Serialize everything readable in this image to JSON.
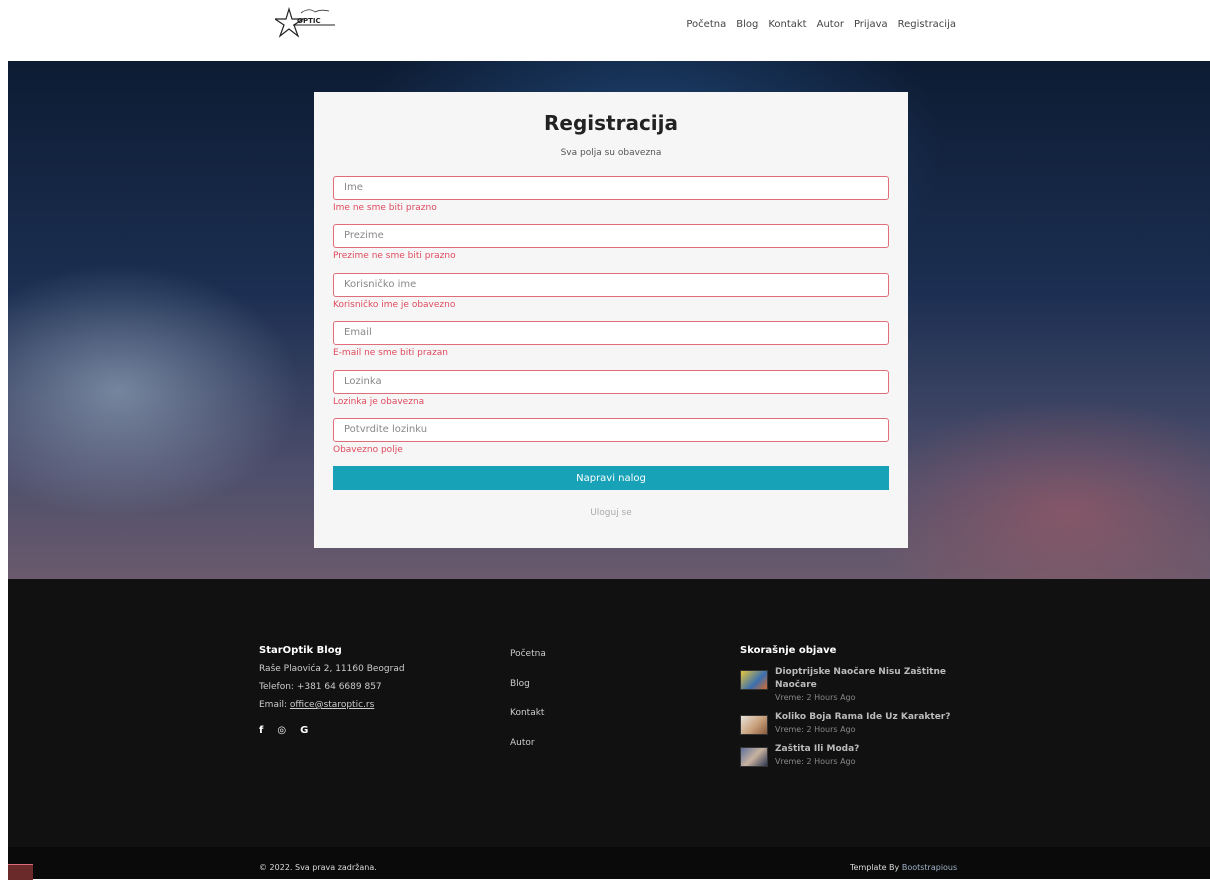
{
  "header": {
    "logo_text": "OPTIC",
    "nav": [
      "Početna",
      "Blog",
      "Kontakt",
      "Autor",
      "Prijava",
      "Registracija"
    ]
  },
  "form": {
    "title": "Registracija",
    "subtitle": "Sva polja su obavezna",
    "fields": [
      {
        "placeholder": "Ime",
        "error": "Ime ne sme biti prazno"
      },
      {
        "placeholder": "Prezime",
        "error": "Prezime ne sme biti prazno"
      },
      {
        "placeholder": "Korisničko ime",
        "error": "Korisničko ime je obavezno"
      },
      {
        "placeholder": "Email",
        "error": "E-mail ne sme biti prazan"
      },
      {
        "placeholder": "Lozinka",
        "error": "Lozinka je obavezna"
      },
      {
        "placeholder": "Potvrdite lozinku",
        "error": "Obavezno polje"
      }
    ],
    "submit_label": "Napravi nalog",
    "login_link": "Uloguj se"
  },
  "footer": {
    "brand": "StarOptik Blog",
    "address": "Raše Plaovića 2, 11160 Beograd",
    "phone": "Telefon: +381 64 6689 857",
    "email_label": "Email:",
    "email": "office@staroptic.rs",
    "socials": [
      "f",
      "◎",
      "G"
    ],
    "links": [
      "Početna",
      "Blog",
      "Kontakt",
      "Autor"
    ],
    "recent_title": "Skorašnje objave",
    "posts": [
      {
        "title": "Dioptrijske Naočare Nisu Zaštitne Naočare",
        "time": "Vreme: 2 Hours Ago"
      },
      {
        "title": "Koliko Boja Rama Ide Uz Karakter?",
        "time": "Vreme: 2 Hours Ago"
      },
      {
        "title": "Zaštita Ili Moda?",
        "time": "Vreme: 2 Hours Ago"
      }
    ],
    "copyright": "© 2022. Sva prava zadržana.",
    "credit_prefix": "Template By",
    "credit_link": "Bootstrapious"
  }
}
